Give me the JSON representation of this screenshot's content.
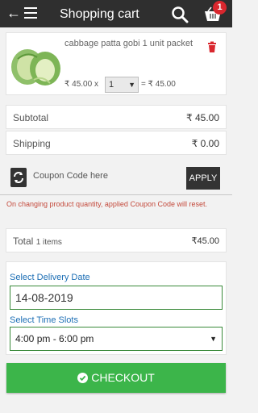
{
  "header": {
    "title": "Shopping cart",
    "back_icon": "arrow-left-icon",
    "menu_icon": "hamburger-icon",
    "search_icon": "search-icon",
    "cart_icon": "cart-icon",
    "cart_count": "1"
  },
  "cart_item": {
    "name": "cabbage patta gobi 1 unit packet",
    "unit_price": "₹ 45.00 x",
    "quantity": "1",
    "line_total": "= ₹ 45.00"
  },
  "summary": {
    "subtotal_label": "Subtotal",
    "subtotal_value": "₹ 45.00",
    "shipping_label": "Shipping",
    "shipping_value": "₹ 0.00"
  },
  "coupon": {
    "placeholder": "Coupon Code here",
    "apply_label": "APPLY",
    "note": "On changing product quantity, applied Coupon Code will reset."
  },
  "total": {
    "label": "Total",
    "items": "1 items",
    "value": "₹45.00"
  },
  "delivery": {
    "date_label": "Select Delivery Date",
    "date_value": "14-08-2019",
    "slot_label": "Select Time Slots",
    "slot_value": "4:00 pm - 6:00 pm"
  },
  "checkout": {
    "label": "CHECKOUT"
  },
  "colors": {
    "accent_green": "#3cb54a",
    "badge_red": "#d9272e",
    "link_blue": "#1d6fb5",
    "note_red": "#c44a3c"
  }
}
